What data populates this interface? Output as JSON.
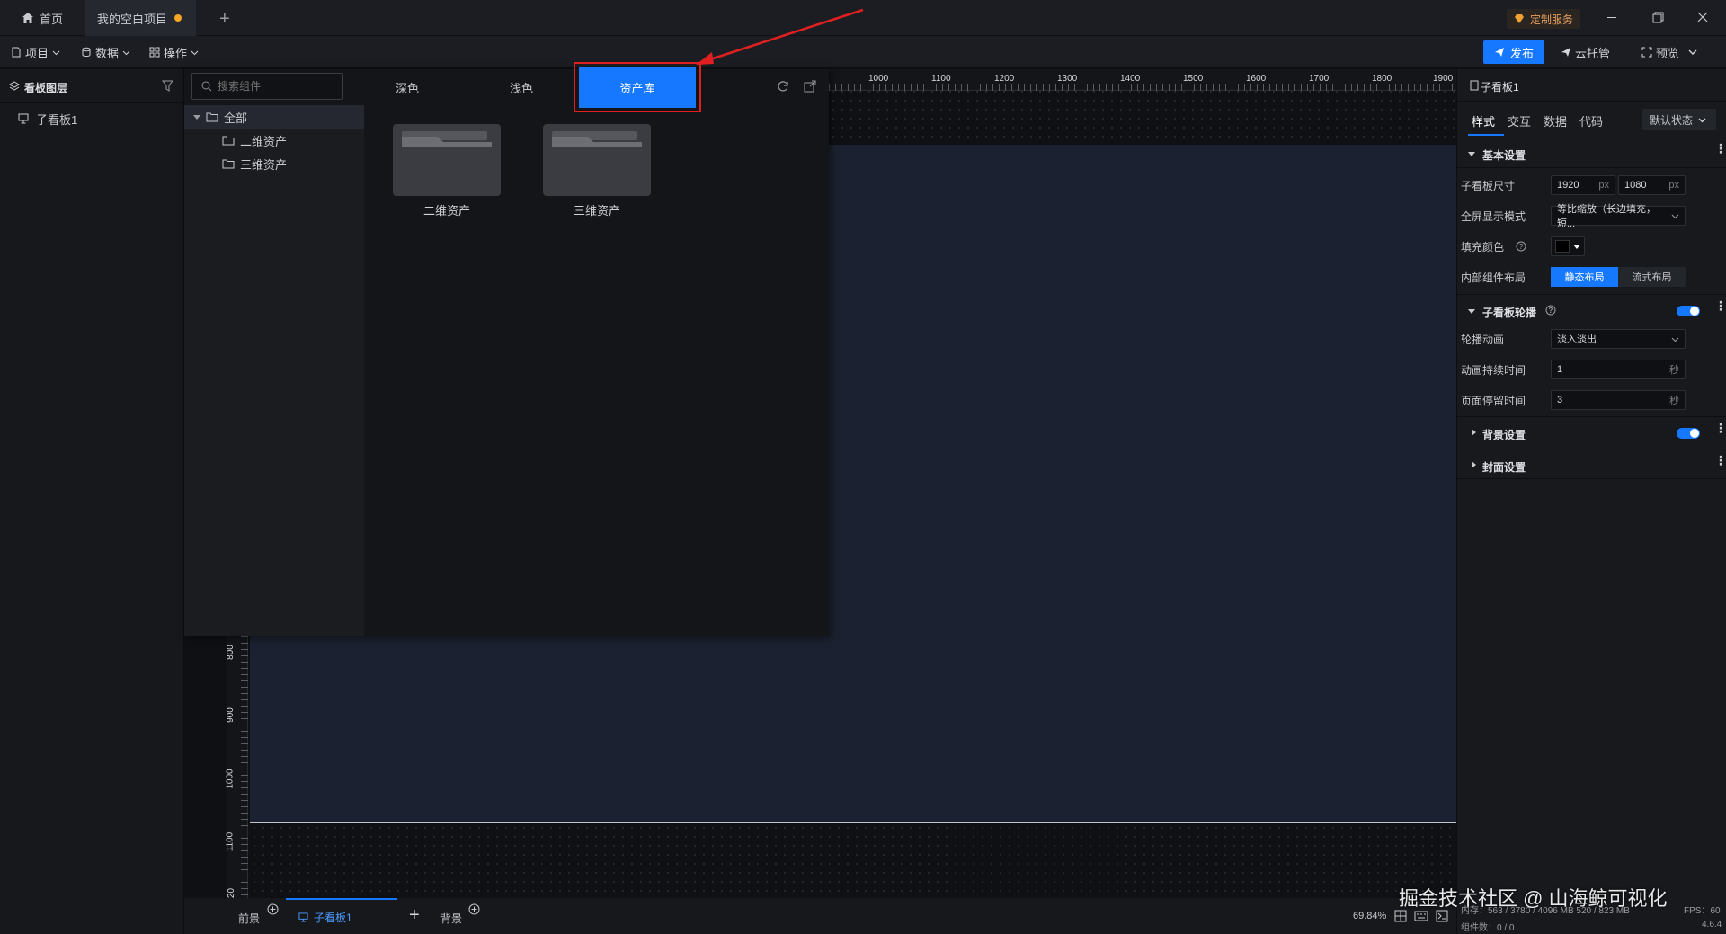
{
  "titlebar": {
    "home_tab": "首页",
    "project_tab": "我的空白项目",
    "custom_service": "定制服务"
  },
  "menubar": {
    "project": "项目",
    "data": "数据",
    "operate": "操作",
    "publish": "发布",
    "cloud_host": "云托管",
    "preview": "预览"
  },
  "layer_panel": {
    "title": "看板图层",
    "items": [
      "子看板1"
    ]
  },
  "asset_popup": {
    "search_placeholder": "搜索组件",
    "tabs": [
      "深色",
      "浅色",
      "资产库"
    ],
    "active_tab": "资产库",
    "tree": {
      "root": "全部",
      "children": [
        "二维资产",
        "三维资产"
      ]
    },
    "folders": [
      "二维资产",
      "三维资产"
    ]
  },
  "ruler": {
    "top_ticks": [
      "1000",
      "1100",
      "1200",
      "1300",
      "1400",
      "1500",
      "1600",
      "1700",
      "1800",
      "1900"
    ],
    "left_ticks": [
      "800",
      "900",
      "1000",
      "1100",
      "20"
    ]
  },
  "right_panel": {
    "title": "子看板1",
    "tabs": [
      "样式",
      "交互",
      "数据",
      "代码"
    ],
    "state_select": "默认状态",
    "basic_settings": "基本设置",
    "size_label": "子看板尺寸",
    "width": "1920",
    "height": "1080",
    "unit_px": "px",
    "fullscreen_label": "全屏显示模式",
    "fullscreen_value": "等比缩放（长边填充，短...",
    "fill_color_label": "填充颜色",
    "fill_color": "#000000",
    "layout_label": "内部组件布局",
    "layout_static": "静态布局",
    "layout_flow": "流式布局",
    "carousel_title": "子看板轮播",
    "carousel_anim_label": "轮播动画",
    "carousel_anim_value": "淡入淡出",
    "anim_duration_label": "动画持续时间",
    "anim_duration_value": "1",
    "stay_time_label": "页面停留时间",
    "stay_time_value": "3",
    "unit_sec": "秒",
    "bg_settings": "背景设置",
    "cover_settings": "封面设置"
  },
  "bottom_bar": {
    "foreground": "前景",
    "board_tab": "子看板1",
    "background": "背景",
    "zoom": "69.84%",
    "memory": "内存：563 / 3780 / 4096 MB  520 / 823 MB",
    "fps": "FPS：60",
    "component_count": "组件数：0 / 0",
    "version": "4.6.4"
  },
  "watermark": "掘金技术社区 @ 山海鲸可视化",
  "colors": {
    "accent": "#1677ff",
    "highlight_border": "#e02020",
    "annotation_arrow": "#e02020"
  }
}
